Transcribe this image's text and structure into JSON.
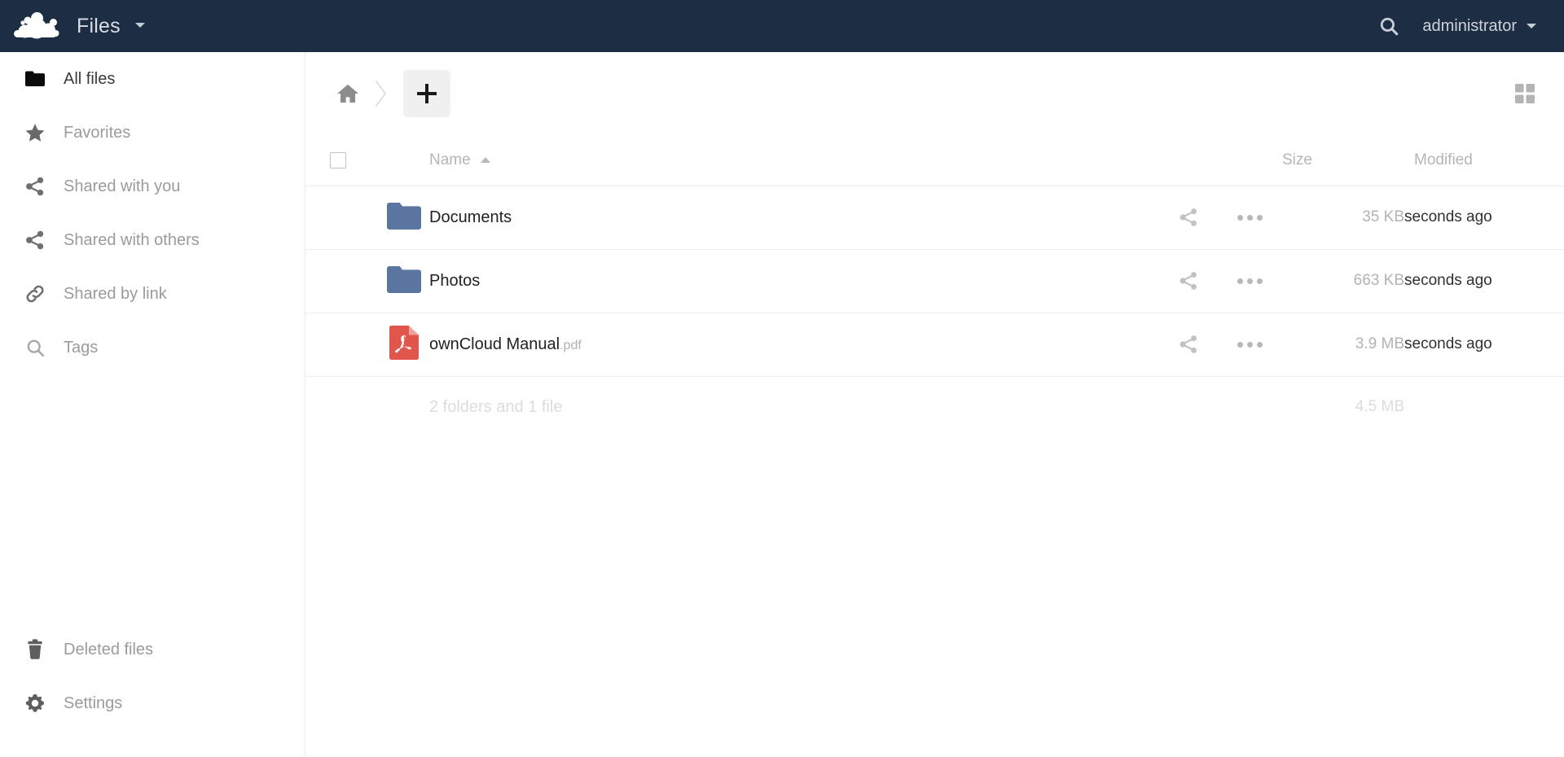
{
  "header": {
    "logo_icon": "owncloud-cloud-logo",
    "app_title": "Files",
    "app_caret_icon": "chevron-down-icon",
    "search_icon": "search-icon",
    "user_name": "administrator",
    "user_caret_icon": "chevron-down-icon",
    "background_color": "#1d2d44"
  },
  "sidebar": {
    "items": [
      {
        "label": "All files",
        "icon": "folder-icon",
        "active": true
      },
      {
        "label": "Favorites",
        "icon": "star-icon",
        "active": false
      },
      {
        "label": "Shared with you",
        "icon": "share-icon",
        "active": false
      },
      {
        "label": "Shared with others",
        "icon": "share-icon",
        "active": false
      },
      {
        "label": "Shared by link",
        "icon": "link-icon",
        "active": false
      },
      {
        "label": "Tags",
        "icon": "search-icon",
        "active": false
      }
    ],
    "bottom_items": [
      {
        "label": "Deleted files",
        "icon": "trash-icon"
      },
      {
        "label": "Settings",
        "icon": "gear-icon"
      }
    ]
  },
  "controls": {
    "home_icon": "home-icon",
    "breadcrumb_separator_icon": "chevron-right-icon",
    "new_button_icon": "plus-icon",
    "new_button_label": "+",
    "view_toggle_icon": "grid-view-icon"
  },
  "table": {
    "select_all_checked": false,
    "columns": {
      "name": "Name",
      "size": "Size",
      "modified": "Modified"
    },
    "sort": {
      "column": "Name",
      "direction": "ascending",
      "icon": "caret-up-icon"
    },
    "rows": [
      {
        "name": "Documents",
        "extension": "",
        "type": "folder",
        "icon": "folder-icon",
        "size": "35 KB",
        "modified": "seconds ago",
        "share_icon": "share-icon",
        "more_icon": "more-actions-icon"
      },
      {
        "name": "Photos",
        "extension": "",
        "type": "folder",
        "icon": "folder-icon",
        "size": "663 KB",
        "modified": "seconds ago",
        "share_icon": "share-icon",
        "more_icon": "more-actions-icon"
      },
      {
        "name": "ownCloud Manual",
        "extension": ".pdf",
        "type": "file",
        "icon": "pdf-file-icon",
        "size": "3.9 MB",
        "modified": "seconds ago",
        "share_icon": "share-icon",
        "more_icon": "more-actions-icon"
      }
    ],
    "summary": {
      "text": "2 folders and 1 file",
      "total_size": "4.5 MB"
    }
  },
  "colors": {
    "header_bg": "#1d2d44",
    "folder_blue": "#5a76a0",
    "pdf_red": "#e0564b",
    "muted_text": "#9b9b9b"
  }
}
